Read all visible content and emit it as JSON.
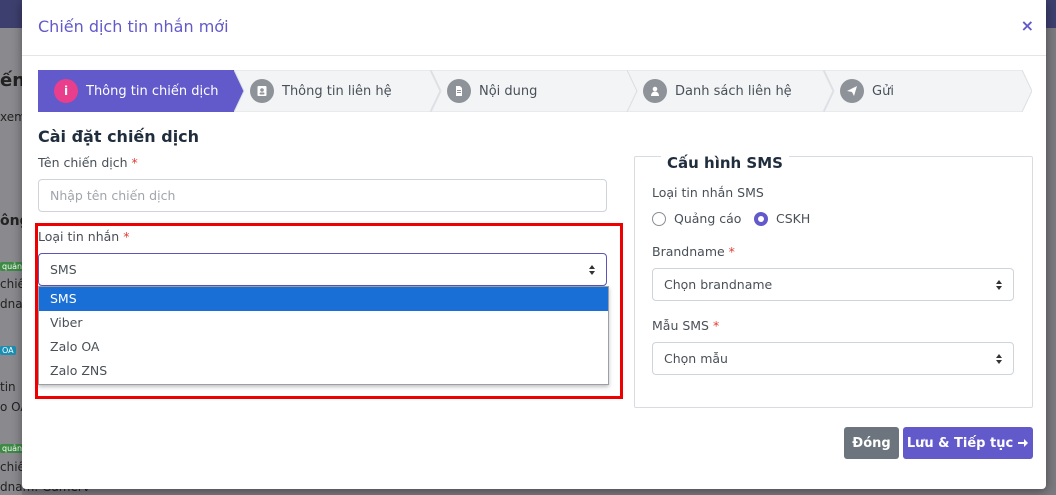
{
  "modal": {
    "title": "Chiến dịch tin nhắn mới",
    "close_label": "×"
  },
  "steps": [
    {
      "label": "Thông tin chiến dịch",
      "icon": "info-icon",
      "active": true
    },
    {
      "label": "Thông tin liên hệ",
      "icon": "contact-card-icon",
      "active": false
    },
    {
      "label": "Nội dung",
      "icon": "document-icon",
      "active": false
    },
    {
      "label": "Danh sách liên hệ",
      "icon": "user-icon",
      "active": false
    },
    {
      "label": "Gửi",
      "icon": "send-icon",
      "active": false
    }
  ],
  "section_title": "Cài đặt chiến dịch",
  "campaign_name": {
    "label": "Tên chiến dịch",
    "required": "*",
    "placeholder": "Nhập tên chiến dịch"
  },
  "message_type": {
    "label": "Loại tin nhắn",
    "required": "*",
    "value": "SMS",
    "options": [
      "SMS",
      "Viber",
      "Zalo OA",
      "Zalo ZNS"
    ]
  },
  "sms_config": {
    "legend": "Cấu hình SMS",
    "type_label": "Loại tin nhắn SMS",
    "radio_options": [
      "Quảng cáo",
      "CSKH"
    ],
    "selected": "CSKH",
    "brandname": {
      "label": "Brandname",
      "required": "*",
      "value": "Chọn brandname"
    },
    "template": {
      "label": "Mẫu SMS",
      "required": "*",
      "value": "Chọn mẫu"
    }
  },
  "buttons": {
    "close": "Đóng",
    "save_continue": "Lưu & Tiếp tục"
  },
  "colors": {
    "accent": "#6259ca",
    "step_active_icon": "#e83e8c",
    "step_inactive_icon": "#8e9399",
    "dropdown_selected": "#1a6fd6",
    "close_button": "#6c757d",
    "highlight_box": "#ee0000"
  },
  "background": {
    "fragments": [
      "ến",
      "xem",
      "ông",
      "quản",
      "chiế",
      "dnam",
      "OA",
      "tin",
      "o OA",
      "quản",
      "chiế",
      "dnam: Gamerv"
    ]
  }
}
